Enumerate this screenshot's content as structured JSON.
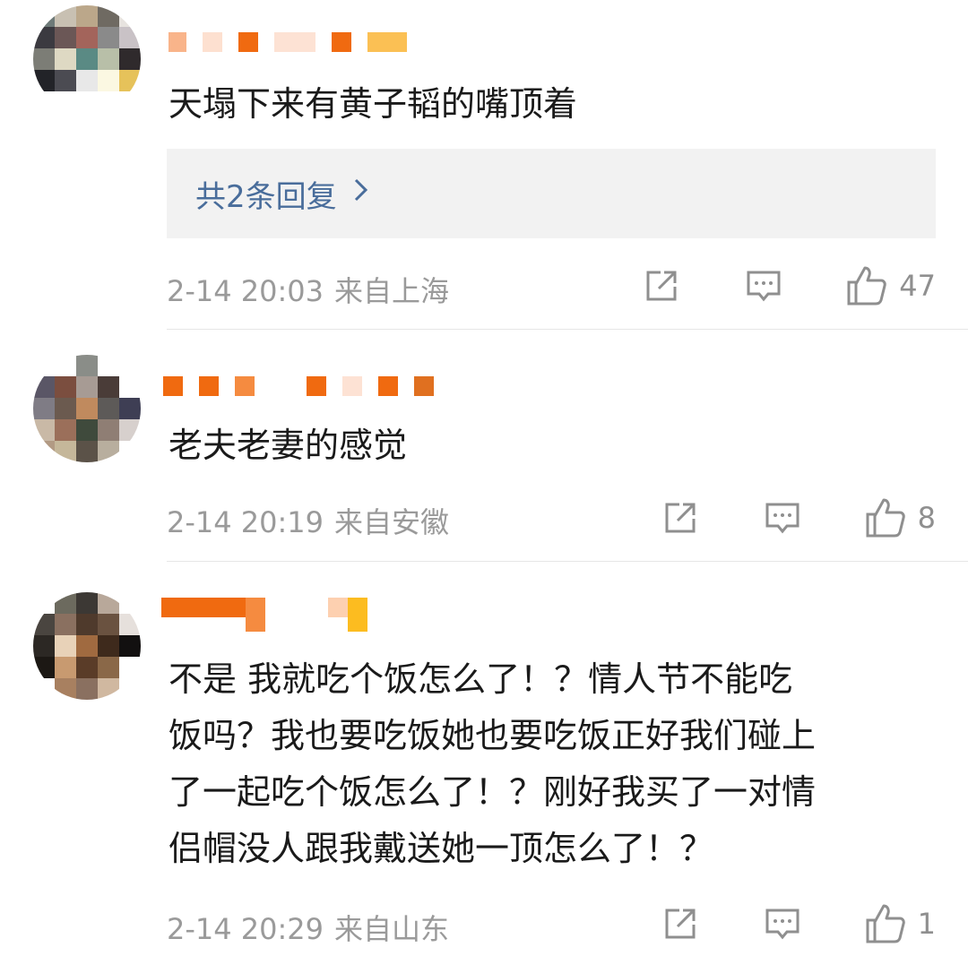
{
  "comments": [
    {
      "text": "天塌下来有黄子韬的嘴顶着",
      "replies_label": "共2条回复",
      "date": "2-14 20:03",
      "location": "来自上海",
      "likes": "47"
    },
    {
      "text": "老夫老妻的感觉",
      "date": "2-14 20:19",
      "location": "来自安徽",
      "likes": "8"
    },
    {
      "text_lines": [
        "不是 我就吃个饭怎么了！？情人节不能吃",
        "饭吗？我也要吃饭她也要吃饭正好我们碰上",
        "了一起吃个饭怎么了！？刚好我买了一对情",
        "侣帽没人跟我戴送她一顶怎么了！？"
      ],
      "date": "2-14 20:29",
      "location": "来自山东",
      "likes": "1"
    }
  ],
  "icons": {
    "share": "share-icon",
    "comment": "comment-icon",
    "like": "thumbs-up-icon",
    "replies_arrow": "chevron-right-icon"
  },
  "colors": {
    "link": "#496d9b",
    "meta": "#9a9a9a",
    "nickname_orange": "#f07a1e"
  }
}
